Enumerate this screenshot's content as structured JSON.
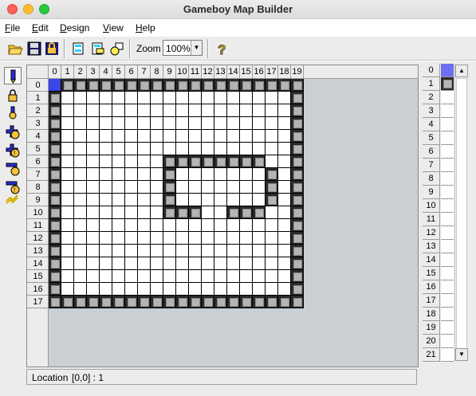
{
  "window": {
    "title": "Gameboy Map Builder"
  },
  "menu": [
    {
      "label": "File",
      "ul": "F",
      "rest": "ile"
    },
    {
      "label": "Edit",
      "ul": "E",
      "rest": "dit"
    },
    {
      "label": "Design",
      "ul": "D",
      "rest": "esign"
    },
    {
      "label": "View",
      "ul": "V",
      "rest": "iew"
    },
    {
      "label": "Help",
      "ul": "H",
      "rest": "elp"
    }
  ],
  "toolbar": {
    "zoom_label": "Zoom",
    "zoom_value": "100%",
    "buttons": [
      "open-icon",
      "save-icon",
      "lock-icon",
      "paste-map-icon",
      "copy-map-icon",
      "objects-icon",
      "help-icon"
    ]
  },
  "tools": [
    "pencil-icon",
    "lock-fill-icon",
    "bulb-icon",
    "insert-col-icon",
    "delete-col-icon",
    "insert-row-icon",
    "delete-row-icon",
    "wave-icon"
  ],
  "map": {
    "columns": [
      "0",
      "1",
      "2",
      "3",
      "4",
      "5",
      "6",
      "7",
      "8",
      "9",
      "10",
      "11",
      "12",
      "13",
      "14",
      "15",
      "16",
      "17",
      "18",
      "19"
    ],
    "rows": [
      "0",
      "1",
      "2",
      "3",
      "4",
      "5",
      "6",
      "7",
      "8",
      "9",
      "10",
      "11",
      "12",
      "13",
      "14",
      "15",
      "16",
      "17"
    ],
    "selected_cell": [
      0,
      0
    ],
    "grid": [
      "01111111111111111111",
      "10000000000000000001",
      "10000000000000000001",
      "10000000000000000001",
      "10000000000000000001",
      "10000000000000000001",
      "10000000011111111001",
      "10000000010000000101",
      "10000000010000000101",
      "10000000010000000101",
      "10000000011100111001",
      "10000000000000000001",
      "10000000000000000001",
      "10000000000000000001",
      "10000000000000000001",
      "10000000000000000001",
      "10000000000000000001",
      "11111111111111111111"
    ]
  },
  "tiles": {
    "numbers": [
      "0",
      "1",
      "2",
      "3",
      "4",
      "5",
      "6",
      "7",
      "8",
      "9",
      "10",
      "11",
      "12",
      "13",
      "14",
      "15",
      "16",
      "17",
      "18",
      "19",
      "20",
      "21"
    ],
    "colors": {
      "tile0": "#6e6ef0",
      "tile1": "wall"
    }
  },
  "status": {
    "label": "Location",
    "value": "[0,0] : 1"
  }
}
